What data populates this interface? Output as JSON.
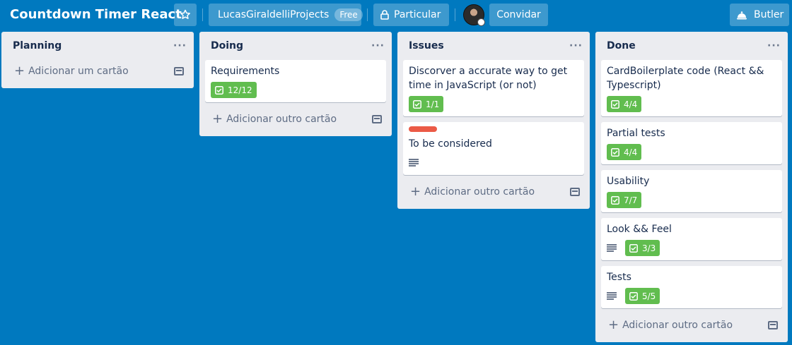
{
  "board": {
    "title": "Countdown Timer React",
    "team_name": "LucasGiraldelliProjects",
    "team_badge": "Free",
    "visibility": "Particular",
    "invite_label": "Convidar",
    "butler_label": "Butler"
  },
  "icons": {
    "star": "star-icon",
    "visibility": "lock-icon",
    "butler": "butler-bell-icon",
    "menu": "ellipsis-icon",
    "add": "plus-icon",
    "template": "card-template-icon",
    "description": "description-icon",
    "checklist": "checklist-icon"
  },
  "colors": {
    "board_bg": "#0079bf",
    "checklist_complete": "#61bd4f",
    "label_red": "#eb5a46"
  },
  "lists": [
    {
      "title": "Planning",
      "menu": "···",
      "add_card": "Adicionar um cartão",
      "cards": []
    },
    {
      "title": "Doing",
      "menu": "···",
      "add_card": "Adicionar outro cartão",
      "cards": [
        {
          "title": "Requirements",
          "checklist": "12/12"
        }
      ]
    },
    {
      "title": "Issues",
      "menu": "···",
      "add_card": "Adicionar outro cartão",
      "cards": [
        {
          "title": "Discorver a accurate way to get time in JavaScript (or not)",
          "checklist": "1/1"
        },
        {
          "title": "To be considered",
          "label": "red",
          "description": true
        }
      ]
    },
    {
      "title": "Done",
      "menu": "···",
      "add_card": "Adicionar outro cartão",
      "cards": [
        {
          "title": "CardBoilerplate code (React && Typescript)",
          "checklist": "4/4"
        },
        {
          "title": "Partial tests",
          "checklist": "4/4"
        },
        {
          "title": "Usability",
          "checklist": "7/7"
        },
        {
          "title": "Look && Feel",
          "description": true,
          "checklist": "3/3"
        },
        {
          "title": "Tests",
          "description": true,
          "checklist": "5/5"
        }
      ]
    }
  ]
}
